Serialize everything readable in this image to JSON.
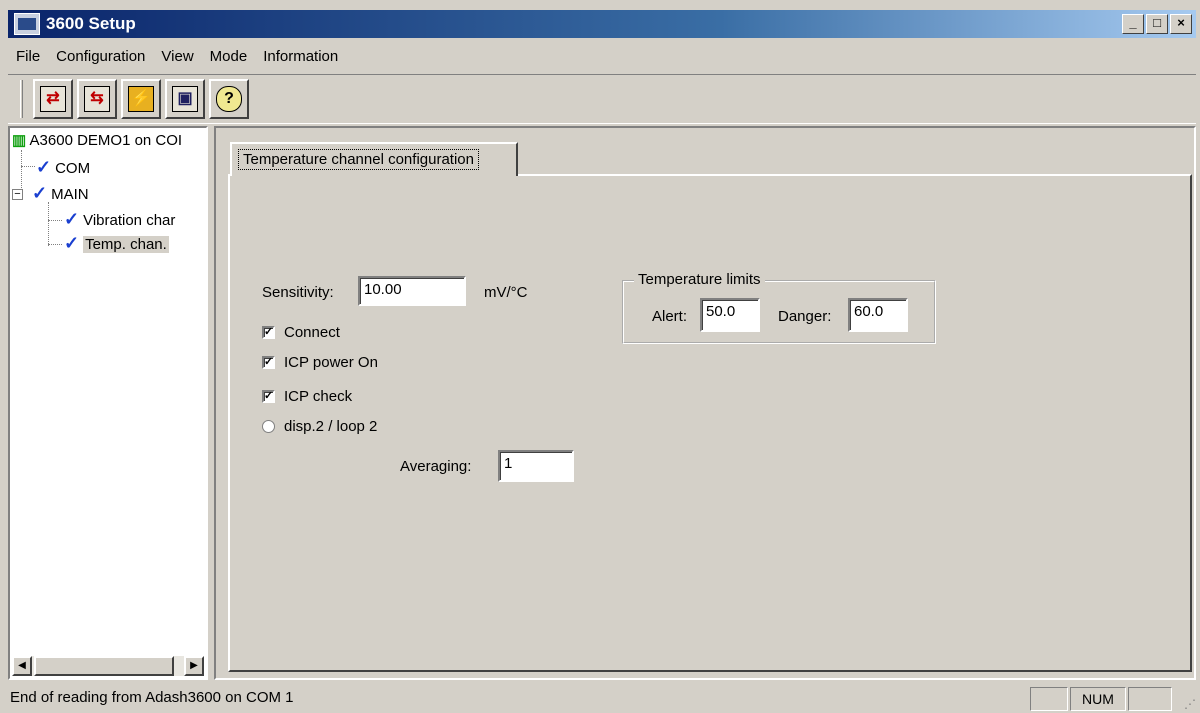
{
  "window": {
    "title": "3600 Setup",
    "min": "_",
    "max": "□",
    "close": "×"
  },
  "menu": [
    "File",
    "Configuration",
    "View",
    "Mode",
    "Information"
  ],
  "toolbar": {
    "buttons": [
      {
        "name": "read-config-icon",
        "glyph": "⇄"
      },
      {
        "name": "write-config-icon",
        "glyph": "⇆"
      },
      {
        "name": "flash-icon",
        "glyph": "⚡"
      },
      {
        "name": "dds-icon",
        "glyph": "▣"
      },
      {
        "name": "help-icon",
        "glyph": "?"
      }
    ]
  },
  "tree": {
    "root": "A3600 DEMO1 on COI",
    "com": "COM",
    "main": "MAIN",
    "vibration": "Vibration char",
    "temp": "Temp. chan."
  },
  "tab": {
    "label": "Temperature channel configuration"
  },
  "form": {
    "sensitivity_label": "Sensitivity:",
    "sensitivity_value": "10.00",
    "sensitivity_unit": "mV/°C",
    "connect_label": "Connect",
    "icp_power_label": "ICP power On",
    "icp_check_label": "ICP check",
    "disp_label": "disp.2 / loop 2",
    "averaging_label": "Averaging:",
    "averaging_value": "1",
    "check_mark": "✓",
    "limits": {
      "title": "Temperature limits",
      "alert_label": "Alert:",
      "alert_value": "50.0",
      "danger_label": "Danger:",
      "danger_value": "60.0"
    }
  },
  "status": {
    "text": "End of reading from Adash3600 on COM 1",
    "num": "NUM"
  },
  "colors": {
    "title_start": "#0a246a",
    "title_end": "#a6caf0",
    "face": "#d4d0c8",
    "check_blue": "#1a3fd0"
  }
}
